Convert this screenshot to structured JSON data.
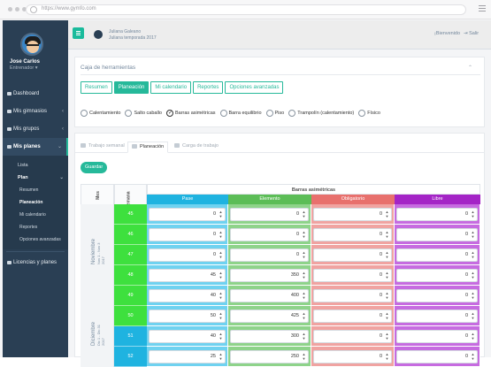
{
  "browser": {
    "url": "https://www.gymfo.com"
  },
  "sidebar": {
    "user_name": "Jose Carlos",
    "user_role": "Entrenador ▾",
    "items": [
      {
        "label": "Dashboard"
      },
      {
        "label": "Mis gimnasios",
        "chevron": "‹"
      },
      {
        "label": "Mis grupos",
        "chevron": "‹"
      },
      {
        "label": "Mis planes",
        "chevron": "⌄"
      }
    ],
    "plans_sub": [
      {
        "label": "Lista"
      },
      {
        "label": "Plan",
        "chevron": "⌄"
      }
    ],
    "plan_sub": [
      {
        "label": "Resumen"
      },
      {
        "label": "Planeación"
      },
      {
        "label": "Mi calendario"
      },
      {
        "label": "Reportes"
      },
      {
        "label": "Opciones avanzadas"
      }
    ],
    "licenses": {
      "label": "Licencias y planes"
    }
  },
  "topbar": {
    "plan_owner": "Juliana Galeano",
    "plan_name": "Juliana temporada 2017",
    "welcome": "¡Bienvenido",
    "logout": "Salir"
  },
  "toolbox": {
    "title": "Caja de herramientas",
    "buttons": [
      "Resumen",
      "Planeación",
      "Mi calendario",
      "Reportes",
      "Opciones avanzadas"
    ],
    "active_button": "Planeación",
    "apparatus": [
      {
        "label": "Calentamiento",
        "selected": false
      },
      {
        "label": "Salto caballo",
        "selected": false
      },
      {
        "label": "Barras asimétricas",
        "selected": true
      },
      {
        "label": "Barra equilibrio",
        "selected": false
      },
      {
        "label": "Piso",
        "selected": false
      },
      {
        "label": "Trampolín (calentamiento)",
        "selected": false
      },
      {
        "label": "Físico",
        "selected": false
      }
    ]
  },
  "tabs": [
    {
      "label": "Trabajo semanal",
      "active": false
    },
    {
      "label": "Planeación",
      "active": true
    },
    {
      "label": "Carga de trabajo",
      "active": false
    }
  ],
  "save_label": "Guardar",
  "table": {
    "col_month": "Mes",
    "col_week": "Semana",
    "apparatus_header": "Barras asimétricas",
    "columns": [
      {
        "label": "Pase",
        "color": "#1fb3e0",
        "light": "#6fd2f0"
      },
      {
        "label": "Elemento",
        "color": "#5cbd57",
        "light": "#8ed38a"
      },
      {
        "label": "Obligatorio",
        "color": "#e8706d",
        "light": "#f0a3a1"
      },
      {
        "label": "Libre",
        "color": "#a424c6",
        "light": "#c66be0"
      }
    ],
    "months": [
      {
        "name": "Noviembre",
        "sub": "Nov 1 - Nov 3",
        "year": "2017"
      },
      {
        "name": "Diciembre",
        "sub": "Dic 1 - Dic 31",
        "year": "2017"
      }
    ],
    "rows": [
      {
        "week": "45",
        "week_color": "#3ee03e",
        "values": [
          "0",
          "0",
          "0",
          "0"
        ]
      },
      {
        "week": "46",
        "week_color": "#3ee03e",
        "values": [
          "0",
          "0",
          "0",
          "0"
        ]
      },
      {
        "week": "47",
        "week_color": "#3ee03e",
        "values": [
          "0",
          "0",
          "0",
          "0"
        ]
      },
      {
        "week": "48",
        "week_color": "#3ee03e",
        "values": [
          "45",
          "350",
          "0",
          "0"
        ]
      },
      {
        "week": "49",
        "week_color": "#3ee03e",
        "values": [
          "40",
          "400",
          "0",
          "0"
        ]
      },
      {
        "week": "50",
        "week_color": "#3ee03e",
        "values": [
          "50",
          "425",
          "0",
          "0"
        ]
      },
      {
        "week": "51",
        "week_color": "#1fb3e0",
        "values": [
          "40",
          "300",
          "0",
          "0"
        ]
      },
      {
        "week": "52",
        "week_color": "#1fb3e0",
        "values": [
          "25",
          "250",
          "0",
          "0"
        ]
      }
    ]
  }
}
